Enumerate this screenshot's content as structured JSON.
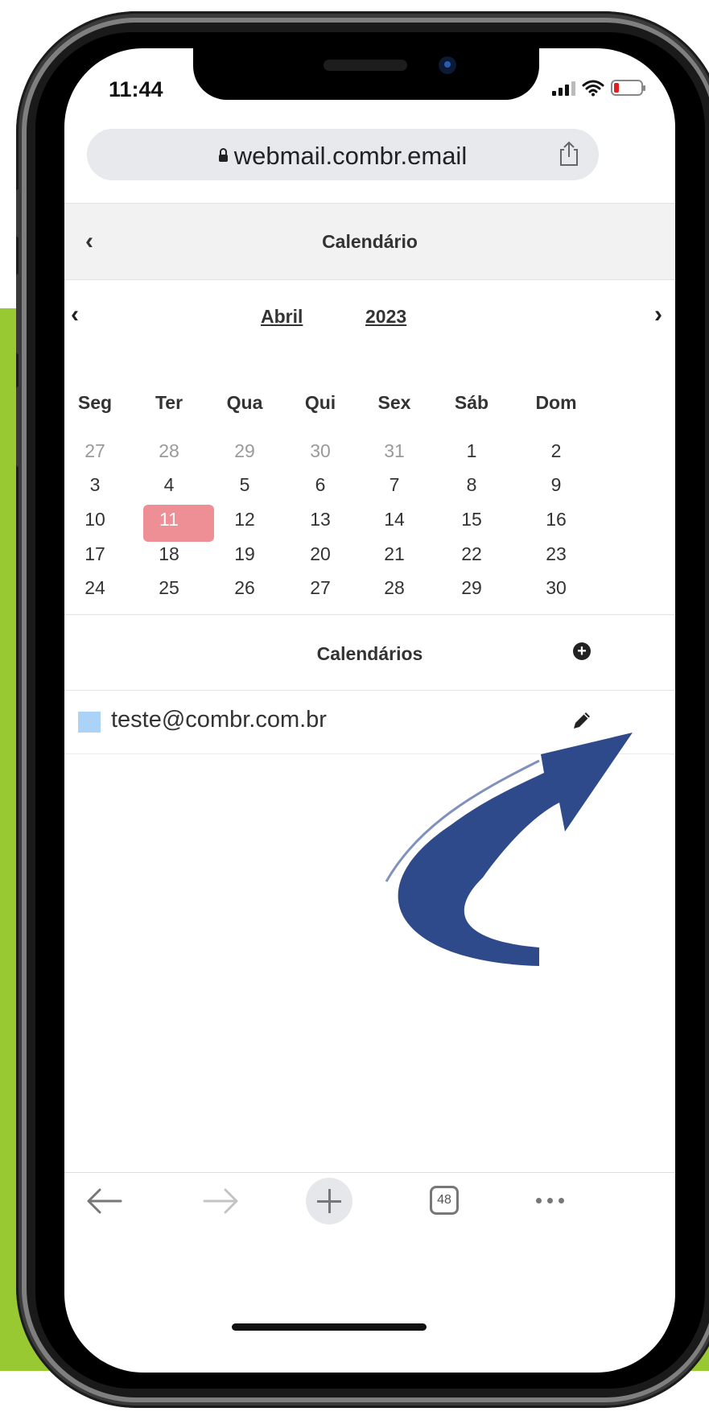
{
  "status_bar": {
    "time": "11:44"
  },
  "browser": {
    "url": "webmail.combr.email",
    "tab_count": "48"
  },
  "header": {
    "title": "Calendário",
    "back_icon": "chevron-left-icon"
  },
  "calendar": {
    "month": "Abril",
    "year": "2023",
    "weekdays": [
      "Seg",
      "Ter",
      "Qua",
      "Qui",
      "Sex",
      "Sáb",
      "Dom"
    ],
    "weeks": [
      [
        "27",
        "28",
        "29",
        "30",
        "31",
        "1",
        "2"
      ],
      [
        "3",
        "4",
        "5",
        "6",
        "7",
        "8",
        "9"
      ],
      [
        "10",
        "11",
        "12",
        "13",
        "14",
        "15",
        "16"
      ],
      [
        "17",
        "18",
        "19",
        "20",
        "21",
        "22",
        "23"
      ],
      [
        "24",
        "25",
        "26",
        "27",
        "28",
        "29",
        "30"
      ]
    ],
    "selected_day": "11",
    "selected_color": "#ee8f96"
  },
  "calendars_section": {
    "title": "Calendários",
    "add_icon": "plus-circle-icon",
    "items": [
      {
        "name": "teste@combr.com.br",
        "color": "#aad3f7",
        "edit_icon": "pencil-icon"
      }
    ]
  },
  "annotation": {
    "arrow_color": "#2f4a8a",
    "arrow_icon": "curved-arrow-icon"
  },
  "background": {
    "accent": "#98c832"
  }
}
